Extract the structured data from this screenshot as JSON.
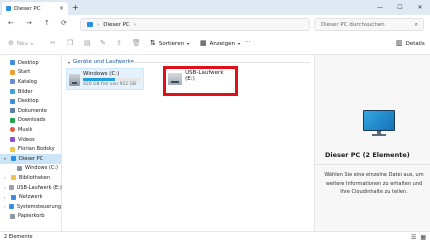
{
  "window": {
    "tab_title": "Dieser PC",
    "new_tab": "+",
    "close_tab": "×",
    "minimize": "—",
    "maximize": "☐",
    "close": "✕"
  },
  "address": {
    "path": "Dieser PC",
    "search_placeholder": "Dieser PC durchsuchen"
  },
  "toolbar": {
    "new_label": "Neu",
    "sort_label": "Sortieren",
    "view_label": "Anzeigen",
    "more_label": "···",
    "details_label": "Details"
  },
  "sidebar": {
    "items": [
      {
        "label": "Desktop",
        "color": "#3b8de0"
      },
      {
        "label": "Start",
        "color": "#f0a030"
      },
      {
        "label": "Katalog",
        "color": "#6a8bd8"
      },
      {
        "label": "Bilder",
        "color": "#3aa0d8"
      },
      {
        "label": "Desktop",
        "color": "#3b8de0"
      },
      {
        "label": "Dokumente",
        "color": "#5b7fa8"
      },
      {
        "label": "Downloads",
        "color": "#1fa34a"
      },
      {
        "label": "Musik",
        "color": "#e0573b"
      },
      {
        "label": "Videos",
        "color": "#8c4fd8"
      },
      {
        "label": "Florian Bodsky",
        "color": "#f2c14e"
      },
      {
        "label": "Dieser PC",
        "color": "#2a8fe0",
        "selected": true
      },
      {
        "label": "Windows (C:)",
        "color": "#8a96a3",
        "sub": true
      },
      {
        "label": "Bibliotheken",
        "color": "#f2c14e"
      },
      {
        "label": "USB-Laufwerk (E:)",
        "color": "#9aa3ad"
      },
      {
        "label": "Netzwerk",
        "color": "#3b8de0"
      },
      {
        "label": "Systemsteuerung",
        "color": "#3b8de0"
      },
      {
        "label": "Papierkorb",
        "color": "#8a96a3"
      }
    ]
  },
  "main": {
    "group_title": "Geräte und Laufwerke",
    "drives": [
      {
        "name": "Windows (C:)",
        "space": "420 GB frei von 952 GB",
        "used_fraction": 0.56
      },
      {
        "name": "USB-Laufwerk (E:)"
      }
    ]
  },
  "details": {
    "title": "Dieser PC (2 Elemente)",
    "text": "Wählen Sie eine einzelne Datei aus, um weitere Informationen zu erhalten und Ihre Cloudinhalte zu teilen."
  },
  "status": {
    "count": "2 Elemente"
  },
  "colors": {
    "accent": "#26a0da",
    "highlight_box": "#e0101a",
    "selection": "#cce4f7"
  }
}
